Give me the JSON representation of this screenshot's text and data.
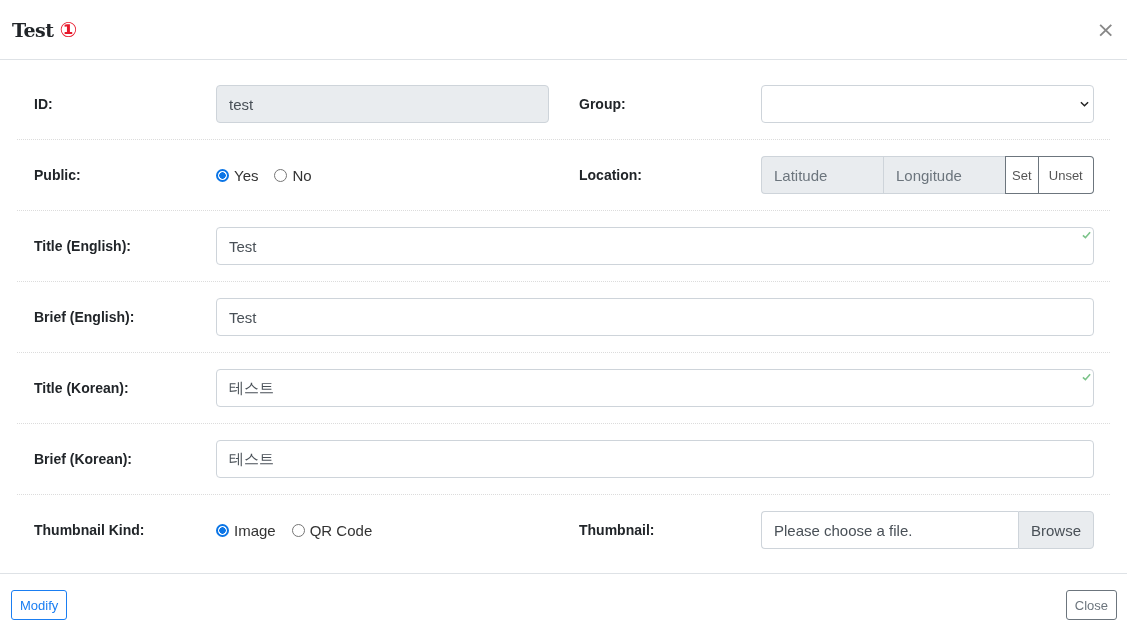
{
  "dialog": {
    "title": "Test",
    "badge": "①",
    "close_symbol": "×"
  },
  "rows": [
    {
      "fields": [
        {
          "kind": "text",
          "label": "ID:",
          "value": "test",
          "disabled": true
        },
        {
          "kind": "select",
          "label": "Group:"
        }
      ]
    },
    {
      "fields": [
        {
          "kind": "radio",
          "label": "Public:",
          "options": [
            {
              "label": "Yes",
              "selected": true
            },
            {
              "label": "No",
              "selected": false
            }
          ]
        },
        {
          "kind": "location",
          "label": "Location:",
          "latitude_placeholder": "Latitude",
          "longitude_placeholder": "Longitude",
          "buttons": [
            "Set",
            "Unset"
          ]
        }
      ]
    },
    {
      "fields": [
        {
          "kind": "text",
          "label": "Title (English):",
          "value": "Test",
          "disabled": false,
          "valid": true
        }
      ]
    },
    {
      "fields": [
        {
          "kind": "text",
          "label": "Brief (English):",
          "value": "Test",
          "disabled": false,
          "valid": false
        }
      ]
    },
    {
      "fields": [
        {
          "kind": "text",
          "label": "Title (Korean):",
          "value": "테스트",
          "disabled": false,
          "valid": true
        }
      ]
    },
    {
      "fields": [
        {
          "kind": "text",
          "label": "Brief (Korean):",
          "value": "테스트",
          "disabled": false,
          "valid": false
        }
      ]
    },
    {
      "fields": [
        {
          "kind": "radio",
          "label": "Thumbnail Kind:",
          "options": [
            {
              "label": "Image",
              "selected": true
            },
            {
              "label": "QR Code",
              "selected": false
            }
          ]
        },
        {
          "kind": "file",
          "label": "Thumbnail:",
          "placeholder": "Please choose a file.",
          "button": "Browse"
        }
      ]
    }
  ],
  "footer": {
    "primary_button": "Modify",
    "close_button": "Close"
  }
}
